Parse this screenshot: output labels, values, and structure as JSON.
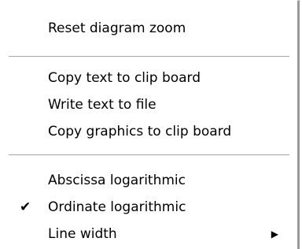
{
  "context_menu": {
    "items": [
      {
        "label": "Reset diagram zoom",
        "checked": false,
        "has_submenu": false
      },
      {
        "label": "Copy text to clip board",
        "checked": false,
        "has_submenu": false
      },
      {
        "label": "Write text to file",
        "checked": false,
        "has_submenu": false
      },
      {
        "label": "Copy graphics to clip board",
        "checked": false,
        "has_submenu": false
      },
      {
        "label": "Abscissa logarithmic",
        "checked": false,
        "has_submenu": false
      },
      {
        "label": "Ordinate logarithmic",
        "checked": true,
        "has_submenu": false
      },
      {
        "label": "Line width",
        "checked": false,
        "has_submenu": true
      }
    ],
    "check_glyph": "✔",
    "submenu_glyph": "▶",
    "separator_color": "#a6a6a6",
    "shadow_color": "#9a9a9a"
  }
}
